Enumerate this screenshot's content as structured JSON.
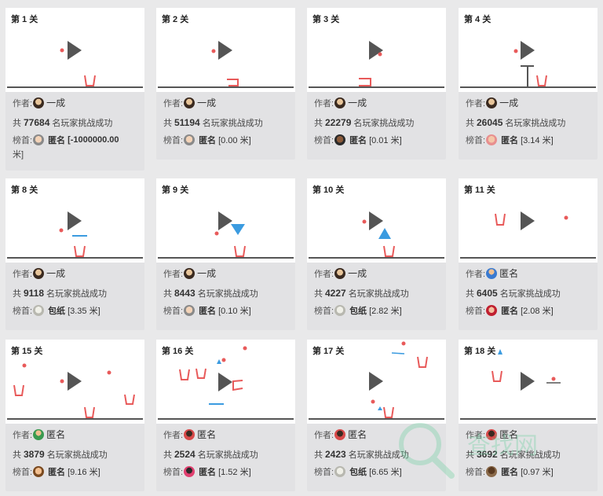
{
  "labels": {
    "author": "作者:",
    "total_prefix": "共",
    "total_suffix": "名玩家挑战成功",
    "rank": "榜首:"
  },
  "colors": {
    "accent_red": "#e85a5a",
    "accent_blue": "#3b9be0",
    "play_icon": "#555555",
    "ground": "#555555"
  },
  "watermark_text": "查找网",
  "levels": [
    {
      "title": "第 1 关",
      "author": "一成",
      "count": "77684",
      "rank_name": "匿名",
      "rank_value": "[-1000000.00 米]"
    },
    {
      "title": "第 2 关",
      "author": "一成",
      "count": "51194",
      "rank_name": "匿名",
      "rank_value": "[0.00 米]"
    },
    {
      "title": "第 3 关",
      "author": "一成",
      "count": "22279",
      "rank_name": "匿名",
      "rank_value": "[0.01 米]"
    },
    {
      "title": "第 4 关",
      "author": "一成",
      "count": "26045",
      "rank_name": "匿名",
      "rank_value": "[3.14 米]"
    },
    {
      "title": "第 8 关",
      "author": "一成",
      "count": "9118",
      "rank_name": "包纸",
      "rank_value": "[3.35 米]"
    },
    {
      "title": "第 9 关",
      "author": "一成",
      "count": "8443",
      "rank_name": "匿名",
      "rank_value": "[0.10 米]"
    },
    {
      "title": "第 10 关",
      "author": "一成",
      "count": "4227",
      "rank_name": "包纸",
      "rank_value": "[2.82 米]"
    },
    {
      "title": "第 11 关",
      "author": "匿名",
      "count": "6405",
      "rank_name": "匿名",
      "rank_value": "[2.08 米]"
    },
    {
      "title": "第 15 关",
      "author": "匿名",
      "count": "3879",
      "rank_name": "匿名",
      "rank_value": "[9.16 米]"
    },
    {
      "title": "第 16 关",
      "author": "匿名",
      "count": "2524",
      "rank_name": "匿名",
      "rank_value": "[1.52 米]"
    },
    {
      "title": "第 17 关",
      "author": "匿名",
      "count": "2423",
      "rank_name": "包纸",
      "rank_value": "[6.65 米]"
    },
    {
      "title": "第 18 关",
      "author": "匿名",
      "count": "3692",
      "rank_name": "匿名",
      "rank_value": "[0.97 米]"
    }
  ]
}
